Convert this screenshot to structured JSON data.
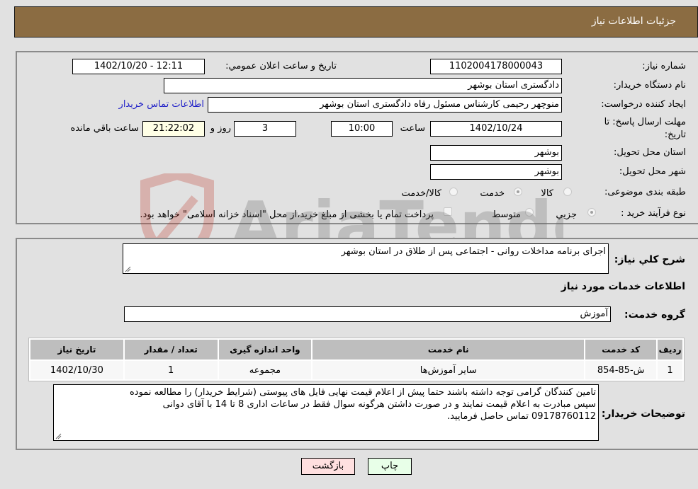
{
  "header": {
    "title": "جزئيات اطلاعات نياز"
  },
  "details": {
    "need_number_label": "شماره نياز:",
    "need_number": "1102004178000043",
    "announce_label": "تاريخ و ساعت اعلان عمومي:",
    "announce_value": "1402/10/20 - 12:11",
    "buyer_org_label": "نام دستگاه خريدار:",
    "buyer_org": "دادگستری استان بوشهر",
    "creator_label": "ايجاد کننده درخواست:",
    "creator": "منوچهر رحیمی کارشناس مسئول رفاه دادگستری استان بوشهر",
    "contact_link": "اطلاعات تماس خريدار",
    "deadline_label_line1": "مهلت ارسال پاسخ: تا",
    "deadline_label_line2": "تاريخ:",
    "deadline_date": "1402/10/24",
    "time_label": "ساعت",
    "deadline_time": "10:00",
    "days_value": "3",
    "days_label": "روز و",
    "remaining_time": "21:22:02",
    "remaining_label": "ساعت باقي مانده",
    "province_label": "استان محل تحويل:",
    "province": "بوشهر",
    "city_label": "شهر محل تحويل:",
    "city": "بوشهر",
    "category_label": "طبقه بندی موضوعی:",
    "category_options": [
      {
        "label": "کالا",
        "checked": false
      },
      {
        "label": "خدمت",
        "checked": true
      },
      {
        "label": "کالا/خدمت",
        "checked": false
      }
    ],
    "process_label": "نوع فرآيند خريد :",
    "process_options": [
      {
        "label": "جزيي",
        "checked": true
      },
      {
        "label": "متوسط",
        "checked": false
      }
    ],
    "treasury_checkbox_label": "پرداخت تمام يا بخشی از مبلغ خريد،از محل \"اسناد خزانه اسلامی\" خواهد بود.",
    "treasury_checked": false
  },
  "summary": {
    "label": "شرح کلي نياز:",
    "value": "اجرای برنامه مداخلات روانی - اجتماعی پس از طلاق در استان بوشهر"
  },
  "services": {
    "section_title": "اطلاعات خدمات مورد نياز",
    "group_label": "گروه خدمت:",
    "group_value": "آموزش",
    "table": {
      "headers": [
        "رديف",
        "کد خدمت",
        "نام خدمت",
        "واحد اندازه گيری",
        "تعداد / مقدار",
        "تاريخ نياز"
      ],
      "rows": [
        [
          "1",
          "ش-85-854",
          "ساير آموزش‌ها",
          "مجموعه",
          "1",
          "1402/10/30"
        ]
      ]
    }
  },
  "buyer_notes": {
    "label": "توضيحات خريدار:",
    "lines": [
      "تامین کنندگان گرامی توجه داشته باشند حتما پیش از اعلام قیمت نهایی فایل های پیوستی (شرایط خریدار) را مطالعه نموده",
      "سپس مبادرت به اعلام قیمت نمایند و در صورت داشتن هرگونه سوال فقط در ساعات اداری 8 تا 14 با آقای دوانی",
      "09178760112 تماس حاصل فرمایید."
    ]
  },
  "buttons": {
    "print": "چاپ",
    "back": "بازگشت"
  },
  "watermark": {
    "text": "AriaTender.neT"
  },
  "colors": {
    "header_bg": "#8b6c42",
    "link": "#2323c8",
    "back_btn": "#ffe0e0",
    "print_btn": "#e8ffe8"
  }
}
